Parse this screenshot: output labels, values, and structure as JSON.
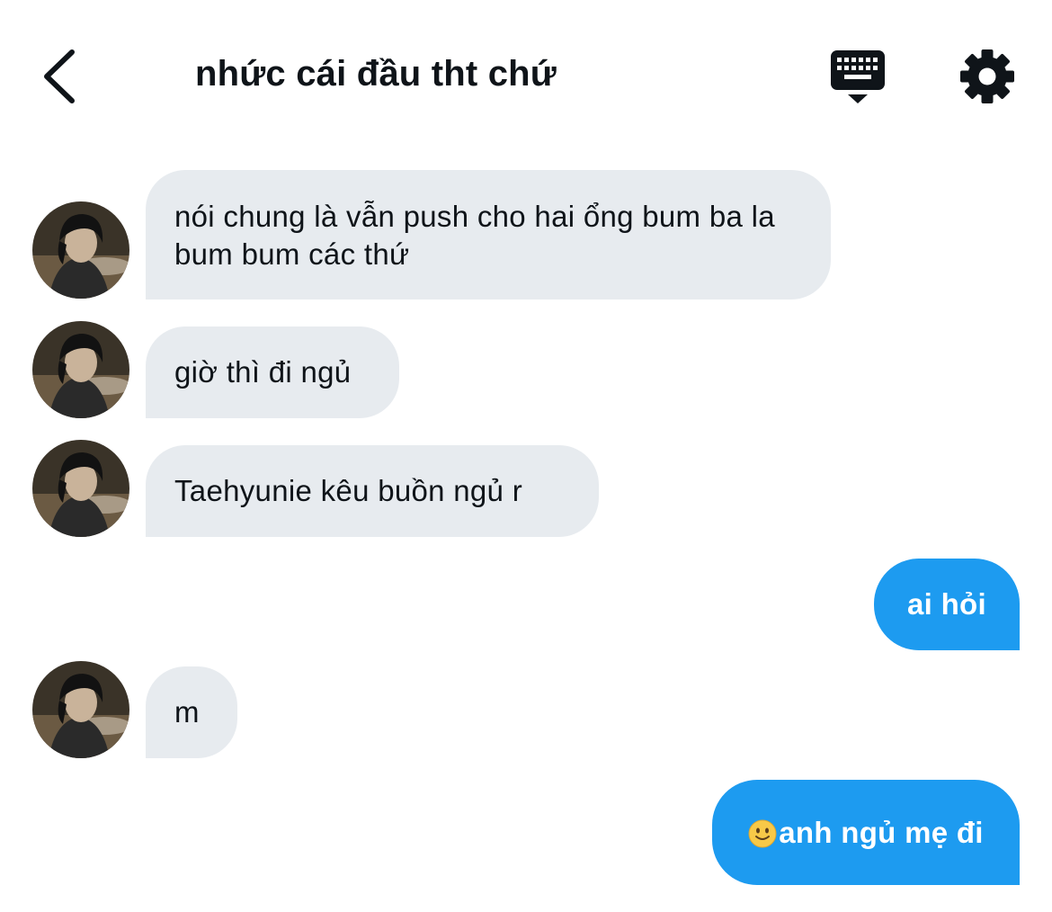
{
  "header": {
    "title": "nhức cái đầu tht chứ"
  },
  "icons": {
    "back": "chevron-left-icon",
    "keyboard": "keyboard-icon",
    "settings": "gear-icon"
  },
  "colors": {
    "incoming_bubble": "#e7ebef",
    "outgoing_bubble": "#1d9bf0",
    "text_primary": "#0f1419"
  },
  "messages": [
    {
      "direction": "in",
      "text": "nói chung là vẫn push cho hai ổng bum ba la bum bum các thứ"
    },
    {
      "direction": "in",
      "text": "giờ thì đi ngủ"
    },
    {
      "direction": "in",
      "text": "Taehyunie kêu buồn ngủ r"
    },
    {
      "direction": "out",
      "text": "ai hỏi"
    },
    {
      "direction": "in",
      "text": "m"
    },
    {
      "direction": "out",
      "emoji": "🙂",
      "text": "anh ngủ mẹ đi"
    }
  ]
}
